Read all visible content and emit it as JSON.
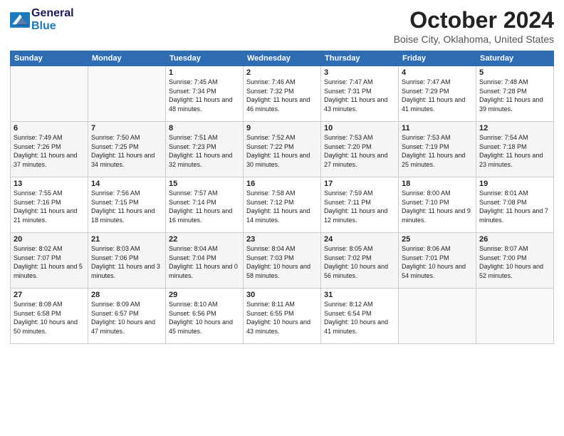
{
  "logo": {
    "line1": "General",
    "line2": "Blue"
  },
  "title": "October 2024",
  "subtitle": "Boise City, Oklahoma, United States",
  "headers": [
    "Sunday",
    "Monday",
    "Tuesday",
    "Wednesday",
    "Thursday",
    "Friday",
    "Saturday"
  ],
  "weeks": [
    [
      {
        "day": "",
        "detail": ""
      },
      {
        "day": "",
        "detail": ""
      },
      {
        "day": "1",
        "detail": "Sunrise: 7:45 AM\nSunset: 7:34 PM\nDaylight: 11 hours\nand 48 minutes."
      },
      {
        "day": "2",
        "detail": "Sunrise: 7:46 AM\nSunset: 7:32 PM\nDaylight: 11 hours\nand 46 minutes."
      },
      {
        "day": "3",
        "detail": "Sunrise: 7:47 AM\nSunset: 7:31 PM\nDaylight: 11 hours\nand 43 minutes."
      },
      {
        "day": "4",
        "detail": "Sunrise: 7:47 AM\nSunset: 7:29 PM\nDaylight: 11 hours\nand 41 minutes."
      },
      {
        "day": "5",
        "detail": "Sunrise: 7:48 AM\nSunset: 7:28 PM\nDaylight: 11 hours\nand 39 minutes."
      }
    ],
    [
      {
        "day": "6",
        "detail": "Sunrise: 7:49 AM\nSunset: 7:26 PM\nDaylight: 11 hours\nand 37 minutes."
      },
      {
        "day": "7",
        "detail": "Sunrise: 7:50 AM\nSunset: 7:25 PM\nDaylight: 11 hours\nand 34 minutes."
      },
      {
        "day": "8",
        "detail": "Sunrise: 7:51 AM\nSunset: 7:23 PM\nDaylight: 11 hours\nand 32 minutes."
      },
      {
        "day": "9",
        "detail": "Sunrise: 7:52 AM\nSunset: 7:22 PM\nDaylight: 11 hours\nand 30 minutes."
      },
      {
        "day": "10",
        "detail": "Sunrise: 7:53 AM\nSunset: 7:20 PM\nDaylight: 11 hours\nand 27 minutes."
      },
      {
        "day": "11",
        "detail": "Sunrise: 7:53 AM\nSunset: 7:19 PM\nDaylight: 11 hours\nand 25 minutes."
      },
      {
        "day": "12",
        "detail": "Sunrise: 7:54 AM\nSunset: 7:18 PM\nDaylight: 11 hours\nand 23 minutes."
      }
    ],
    [
      {
        "day": "13",
        "detail": "Sunrise: 7:55 AM\nSunset: 7:16 PM\nDaylight: 11 hours\nand 21 minutes."
      },
      {
        "day": "14",
        "detail": "Sunrise: 7:56 AM\nSunset: 7:15 PM\nDaylight: 11 hours\nand 18 minutes."
      },
      {
        "day": "15",
        "detail": "Sunrise: 7:57 AM\nSunset: 7:14 PM\nDaylight: 11 hours\nand 16 minutes."
      },
      {
        "day": "16",
        "detail": "Sunrise: 7:58 AM\nSunset: 7:12 PM\nDaylight: 11 hours\nand 14 minutes."
      },
      {
        "day": "17",
        "detail": "Sunrise: 7:59 AM\nSunset: 7:11 PM\nDaylight: 11 hours\nand 12 minutes."
      },
      {
        "day": "18",
        "detail": "Sunrise: 8:00 AM\nSunset: 7:10 PM\nDaylight: 11 hours\nand 9 minutes."
      },
      {
        "day": "19",
        "detail": "Sunrise: 8:01 AM\nSunset: 7:08 PM\nDaylight: 11 hours\nand 7 minutes."
      }
    ],
    [
      {
        "day": "20",
        "detail": "Sunrise: 8:02 AM\nSunset: 7:07 PM\nDaylight: 11 hours\nand 5 minutes."
      },
      {
        "day": "21",
        "detail": "Sunrise: 8:03 AM\nSunset: 7:06 PM\nDaylight: 11 hours\nand 3 minutes."
      },
      {
        "day": "22",
        "detail": "Sunrise: 8:04 AM\nSunset: 7:04 PM\nDaylight: 11 hours\nand 0 minutes."
      },
      {
        "day": "23",
        "detail": "Sunrise: 8:04 AM\nSunset: 7:03 PM\nDaylight: 10 hours\nand 58 minutes."
      },
      {
        "day": "24",
        "detail": "Sunrise: 8:05 AM\nSunset: 7:02 PM\nDaylight: 10 hours\nand 56 minutes."
      },
      {
        "day": "25",
        "detail": "Sunrise: 8:06 AM\nSunset: 7:01 PM\nDaylight: 10 hours\nand 54 minutes."
      },
      {
        "day": "26",
        "detail": "Sunrise: 8:07 AM\nSunset: 7:00 PM\nDaylight: 10 hours\nand 52 minutes."
      }
    ],
    [
      {
        "day": "27",
        "detail": "Sunrise: 8:08 AM\nSunset: 6:58 PM\nDaylight: 10 hours\nand 50 minutes."
      },
      {
        "day": "28",
        "detail": "Sunrise: 8:09 AM\nSunset: 6:57 PM\nDaylight: 10 hours\nand 47 minutes."
      },
      {
        "day": "29",
        "detail": "Sunrise: 8:10 AM\nSunset: 6:56 PM\nDaylight: 10 hours\nand 45 minutes."
      },
      {
        "day": "30",
        "detail": "Sunrise: 8:11 AM\nSunset: 6:55 PM\nDaylight: 10 hours\nand 43 minutes."
      },
      {
        "day": "31",
        "detail": "Sunrise: 8:12 AM\nSunset: 6:54 PM\nDaylight: 10 hours\nand 41 minutes."
      },
      {
        "day": "",
        "detail": ""
      },
      {
        "day": "",
        "detail": ""
      }
    ]
  ]
}
